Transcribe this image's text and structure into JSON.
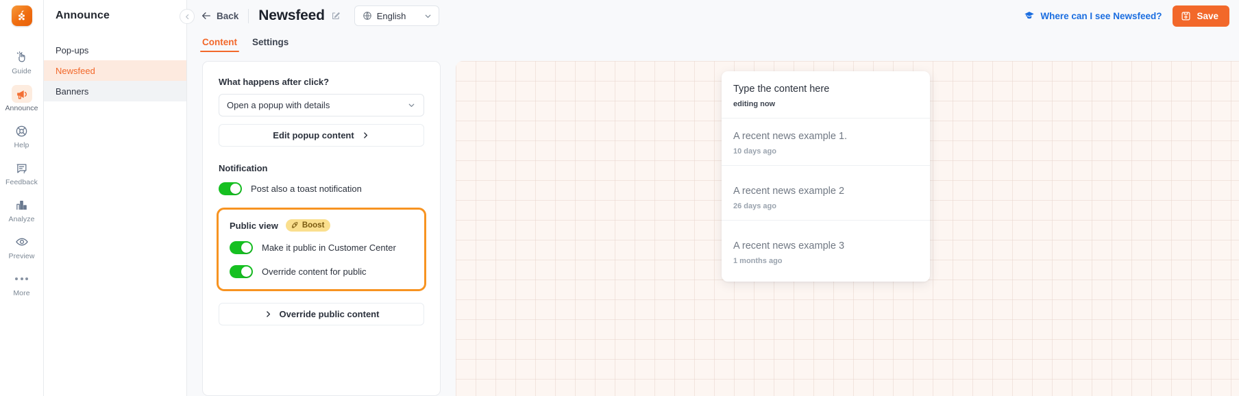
{
  "rail": {
    "logo_icon": "grape-logo-icon",
    "items": [
      {
        "label": "Guide",
        "icon": "hand-click-icon",
        "active": false
      },
      {
        "label": "Announce",
        "icon": "megaphone-icon",
        "active": true
      },
      {
        "label": "Help",
        "icon": "lifebuoy-icon",
        "active": false
      },
      {
        "label": "Feedback",
        "icon": "chat-question-icon",
        "active": false
      },
      {
        "label": "Analyze",
        "icon": "bar-chart-icon",
        "active": false
      },
      {
        "label": "Preview",
        "icon": "eye-icon",
        "active": false
      },
      {
        "label": "More",
        "icon": "ellipsis-icon",
        "active": false
      }
    ]
  },
  "sidebar": {
    "title": "Announce",
    "items": [
      {
        "label": "Pop-ups",
        "state": "default"
      },
      {
        "label": "Newsfeed",
        "state": "active"
      },
      {
        "label": "Banners",
        "state": "hover"
      }
    ]
  },
  "topbar": {
    "collapse_icon": "chevron-left-circle-icon",
    "back_label": "Back",
    "back_icon": "arrow-left-icon",
    "page_title": "Newsfeed",
    "edit_title_icon": "pencil-edit-icon",
    "language": {
      "icon": "globe-icon",
      "value": "English",
      "chevron": "chevron-down-icon"
    },
    "help_link": {
      "icon": "graduation-cap-icon",
      "label": "Where can I see Newsfeed?",
      "color": "#1b6ee0"
    },
    "save": {
      "icon": "floppy-save-icon",
      "label": "Save",
      "color": "#f2682a"
    }
  },
  "tabs": [
    {
      "label": "Content",
      "active": true
    },
    {
      "label": "Settings",
      "active": false
    }
  ],
  "settings": {
    "after_click": {
      "label": "What happens after click?",
      "value": "Open a popup with details",
      "chevron": "chevron-down-icon"
    },
    "edit_popup": {
      "label": "Edit popup content",
      "icon": "chevron-right-icon"
    },
    "notification": {
      "heading": "Notification",
      "toggle_label": "Post also a toast notification",
      "toggle_on": true
    },
    "public_view": {
      "heading": "Public view",
      "badge": {
        "label": "Boost",
        "icon": "rocket-icon",
        "bg": "#fadf8e",
        "fg": "#7a5a10"
      },
      "highlight_color": "#f79321",
      "toggles": [
        {
          "label": "Make it public in Customer Center",
          "on": true
        },
        {
          "label": "Override content for public",
          "on": true
        }
      ]
    },
    "override_button": {
      "label": "Override public content",
      "icon": "chevron-right-icon"
    },
    "toggle_on_color": "#16c021"
  },
  "preview": {
    "newsfeed_items": [
      {
        "title": "Type the content here",
        "meta": "editing now",
        "editing": true
      },
      {
        "title": "A recent news example 1.",
        "meta": "10 days ago",
        "editing": false
      },
      {
        "title": "A recent news example 2",
        "meta": "26 days ago",
        "editing": false
      },
      {
        "title": "A recent news example 3",
        "meta": "1 months ago",
        "editing": false
      }
    ]
  }
}
